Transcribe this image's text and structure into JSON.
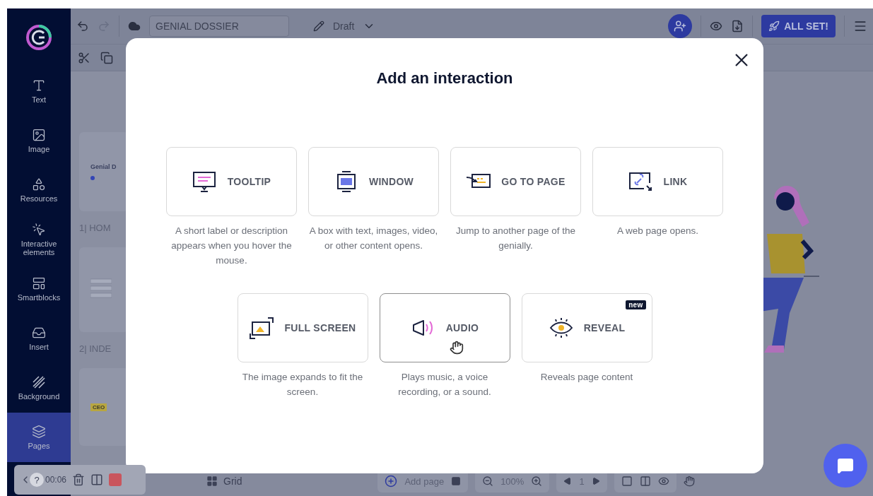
{
  "sidebar": {
    "items": [
      {
        "kind": "text",
        "label": "Text",
        "selected": false
      },
      {
        "kind": "image",
        "label": "Image",
        "selected": false
      },
      {
        "kind": "resources",
        "label": "Resources",
        "selected": false
      },
      {
        "kind": "interactive",
        "label": "Interactive elements",
        "selected": false
      },
      {
        "kind": "smartblocks",
        "label": "Smartblocks",
        "selected": false
      },
      {
        "kind": "insert",
        "label": "Insert",
        "selected": false
      },
      {
        "kind": "background",
        "label": "Background",
        "selected": false
      },
      {
        "kind": "pages",
        "label": "Pages",
        "selected": true
      }
    ]
  },
  "toolbar": {
    "title_field": "GENIAL DOSSIER",
    "status": "Draft",
    "publish_button": "ALL SET!"
  },
  "pages_panel": {
    "pages": [
      {
        "kind": "cover",
        "heading": "Genial D",
        "label": "1| HOM"
      },
      {
        "kind": "index",
        "label": "2| INDE"
      },
      {
        "kind": "profile",
        "badge": "CEO"
      }
    ]
  },
  "bottom_bar": {
    "view": "Grid",
    "add_page": "Add page",
    "zoom": "100%",
    "page": "1"
  },
  "recorder": {
    "help": "?",
    "time": "00:06"
  },
  "modal": {
    "title": "Add an interaction",
    "options": [
      {
        "kind": "tooltip",
        "label": "TOOLTIP",
        "description": "A short label or description appears when you hover the mouse.",
        "hovered": false
      },
      {
        "kind": "window",
        "label": "WINDOW",
        "description": "A box with text, images, video, or other content opens.",
        "hovered": false
      },
      {
        "kind": "goto",
        "label": "GO TO PAGE",
        "description": "Jump to another page of the genially.",
        "hovered": false
      },
      {
        "kind": "link",
        "label": "LINK",
        "description": "A web page opens.",
        "hovered": false
      },
      {
        "kind": "fullscreen",
        "label": "FULL SCREEN",
        "description": "The image expands to fit the screen.",
        "hovered": false
      },
      {
        "kind": "audio",
        "label": "AUDIO",
        "description": "Plays music, a voice recording, or a sound.",
        "hovered": true
      },
      {
        "kind": "reveal",
        "label": "REVEAL",
        "description": "Reveals page content",
        "hovered": false,
        "badge": "new"
      }
    ]
  }
}
